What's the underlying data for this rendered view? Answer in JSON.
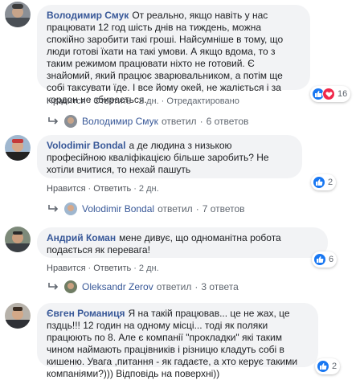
{
  "colors": {
    "name_link": "#385898",
    "bubble_bg": "#f2f3f5",
    "meta_text": "#606770",
    "like_blue": "#1877f2",
    "love_red": "#f0284a"
  },
  "comments": [
    {
      "author": "Володимир Смук",
      "text": "От реально, якщо навіть у нас працювати 12 год шість днів на тиждень, можна спокійно заробити такі гроші. Найсумніше в тому, що люди готові їхати на такі умови. А якщо вдома, то з таким режимом працювати ніхто не готовий. Є знайомий, який працює зварювальником, а потім ще собі таксувати їде. І все йому окей, не жаліється і за кордон не збирається.",
      "like": "Нравится",
      "reply": "Ответить",
      "time": "2 дн.",
      "edited": "Отредактировано",
      "reactions_count": "16",
      "reactions": [
        "like-icon",
        "love-icon"
      ],
      "replied_by": "Володимир Смук",
      "replied_word": "ответил",
      "reply_count": "6 ответов"
    },
    {
      "author": "Volodimir Bondal",
      "text": "а де людина з низькою професійною кваліфікацією більше заробить? Не хотіли вчитися, то нехай пашуть",
      "like": "Нравится",
      "reply": "Ответить",
      "time": "2 дн.",
      "reactions_count": "2",
      "reactions": [
        "like-icon"
      ],
      "replied_by": "Volodimir Bondal",
      "replied_word": "ответил",
      "reply_count": "7 ответов"
    },
    {
      "author": "Андрий Коман",
      "text": "мене дивує, що одноманітна робота подається як перевага!",
      "like": "Нравится",
      "reply": "Ответить",
      "time": "2 дн.",
      "reactions_count": "6",
      "reactions": [
        "like-icon"
      ],
      "replied_by": "Oleksandr Zerov",
      "replied_word": "ответил",
      "reply_count": "3 ответа"
    },
    {
      "author": "Євген Романиця",
      "text": "Я на такій працював... це не жах, це пздць!!! 12 годин на одному місці... тоді як поляки працюють по 8. Але є компанії \"прокладки\" які таким чином наймають працівників і різницю кладуть собі в кишеню. Увага ,питання - як гадаєте, а хто керує такими компаніями?))) Відповідь на поверхні))",
      "reactions_count": "2",
      "reactions": [
        "like-icon"
      ]
    }
  ]
}
